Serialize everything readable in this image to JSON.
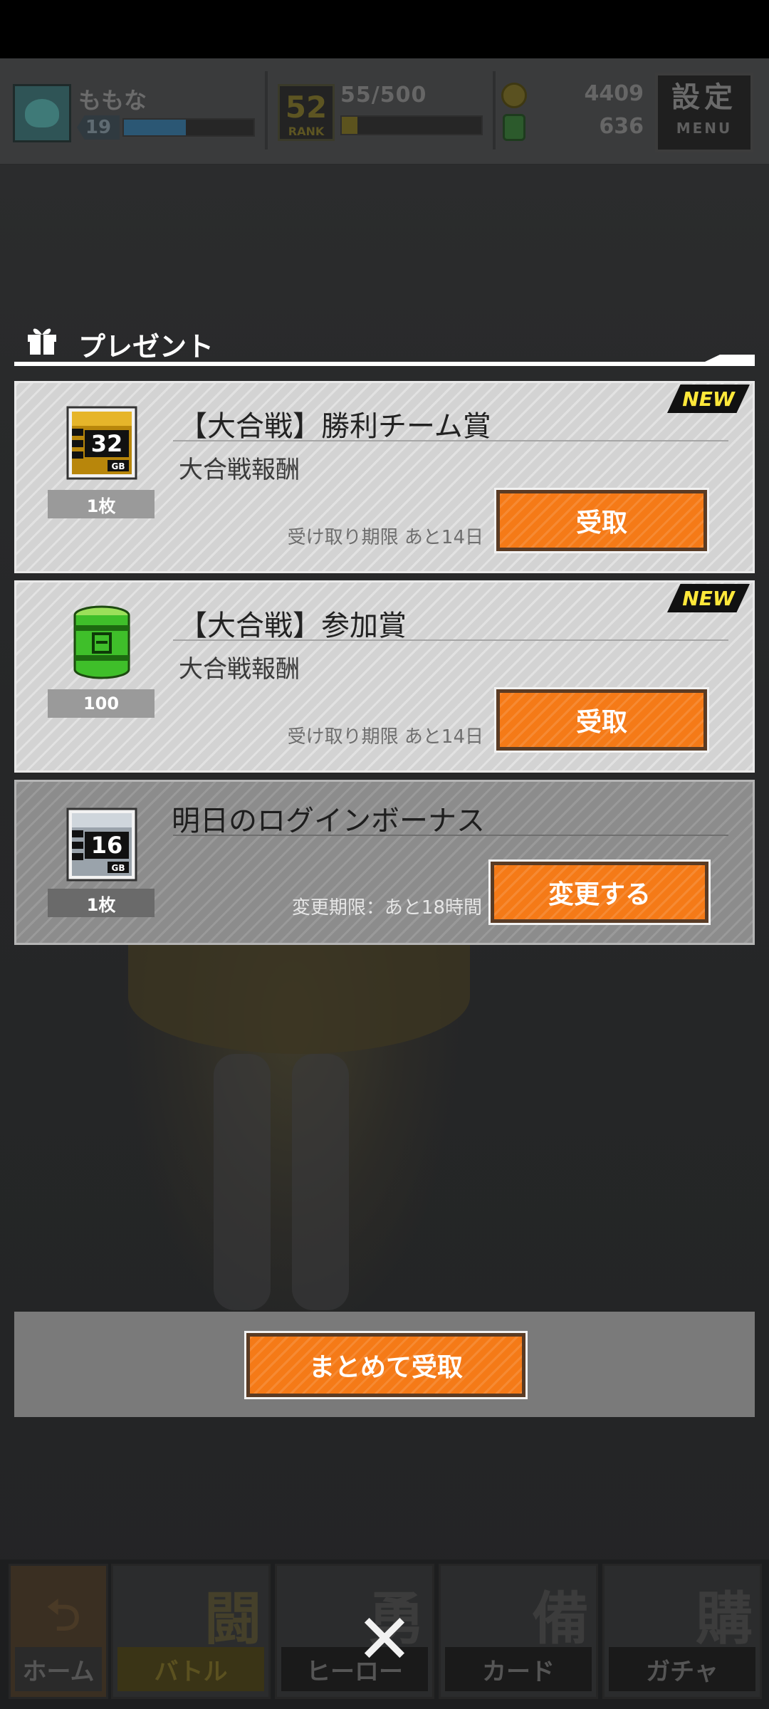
{
  "header": {
    "player_name": "ももな",
    "level": "19",
    "exp_fraction": 0.48,
    "rank": "52",
    "rank_label": "RANK",
    "stamina": "55/500",
    "stamina_fraction": 0.11,
    "coins": "4409",
    "cans": "636",
    "menu_kanji": "設定",
    "menu_label": "MENU"
  },
  "modal": {
    "title": "プレゼント",
    "items": [
      {
        "new": "NEW",
        "title": "【大合戦】勝利チーム賞",
        "subtitle": "大合戦報酬",
        "quantity": "1枚",
        "icon": "sim-card-32gb-icon",
        "icon_text": "32",
        "icon_unit": "GB",
        "deadline": "受け取り期限 あと14日",
        "button": "受取"
      },
      {
        "new": "NEW",
        "title": "【大合戦】参加賞",
        "subtitle": "大合戦報酬",
        "quantity": "100",
        "icon": "green-can-icon",
        "deadline": "受け取り期限 あと14日",
        "button": "受取"
      },
      {
        "title": "明日のログインボーナス",
        "quantity": "1枚",
        "icon": "sim-card-16gb-icon",
        "icon_text": "16",
        "icon_unit": "GB",
        "deadline": "変更期限：あと18時間",
        "button": "変更する"
      }
    ],
    "bulk_button": "まとめて受取",
    "close_glyph": "✕"
  },
  "nav": [
    {
      "kanji": "",
      "label": "ホーム"
    },
    {
      "kanji": "闘",
      "label": "バトル"
    },
    {
      "kanji": "勇",
      "label": "ヒーロー"
    },
    {
      "kanji": "備",
      "label": "カード"
    },
    {
      "kanji": "購",
      "label": "ガチャ"
    }
  ],
  "colors": {
    "accent_orange": "#f57a17",
    "new_badge_text": "#ffe83a"
  }
}
